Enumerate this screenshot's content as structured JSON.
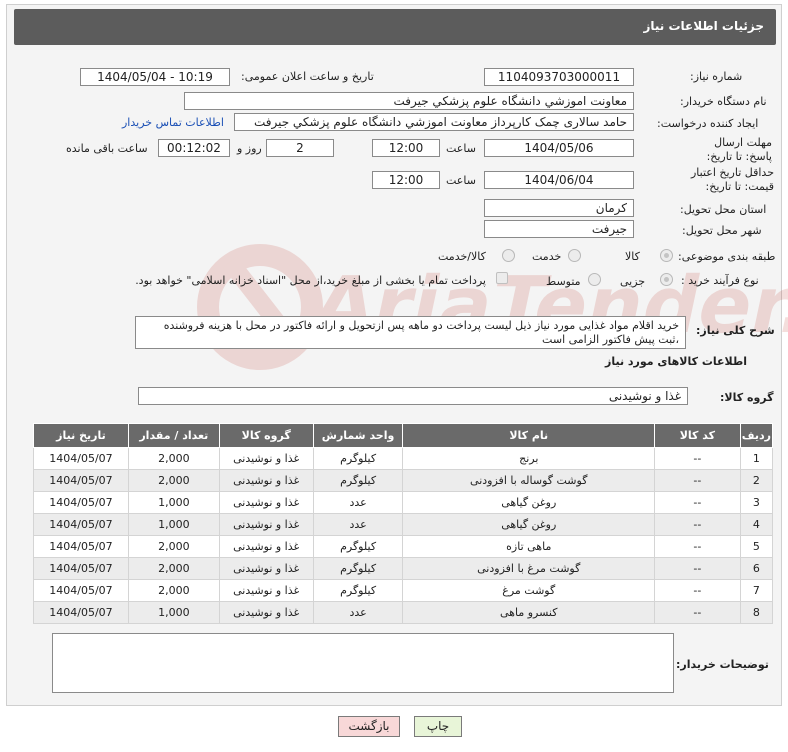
{
  "title": "جزئیات اطلاعات نیاز",
  "fields": {
    "need_number_label": "شماره نیاز:",
    "need_number": "1104093703000011",
    "announce_label": "تاریخ و ساعت اعلان عمومی:",
    "announce_value": "1404/05/04 - 10:19",
    "buyer_org_label": "نام دستگاه خریدار:",
    "buyer_org": "معاونت اموزشي دانشگاه علوم پزشکي جيرفت",
    "creator_label": "ایجاد کننده درخواست:",
    "creator": "حامد سالاری چمک کارپرداز معاونت اموزشي دانشگاه علوم پزشکي جيرفت",
    "contact_link": "اطلاعات تماس خریدار",
    "reply_deadline_label": "مهلت ارسال پاسخ: تا تاریخ:",
    "reply_date": "1404/05/06",
    "time_label": "ساعت",
    "reply_time": "12:00",
    "days_value": "2",
    "days_label": "روز و",
    "remaining_time": "00:12:02",
    "remaining_label": "ساعت باقی مانده",
    "price_validity_label": "حداقل تاریخ اعتبار قیمت: تا تاریخ:",
    "price_date": "1404/06/04",
    "price_time": "12:00",
    "province_label": "استان محل تحویل:",
    "province": "کرمان",
    "city_label": "شهر محل تحویل:",
    "city": "جيرفت",
    "category_label": "طبقه بندی موضوعی:",
    "cat_goods": "کالا",
    "cat_service": "خدمت",
    "cat_goods_service": "کالا/خدمت",
    "process_label": "نوع فرآیند خرید :",
    "proc_small": "جزیی",
    "proc_medium": "متوسط",
    "payment_note": "پرداخت تمام یا بخشی از مبلغ خرید،از محل \"اسناد خزانه اسلامی\" خواهد بود.",
    "description_label": "شرح کلی نیاز:",
    "description": "خرید اقلام مواد غذایی مورد نیاز ذیل لیست پرداخت دو ماهه پس ازتحویل و ارائه فاکتور در محل با هزینه فروشنده ،ثبت پیش فاکتور الزامی است",
    "goods_info_title": "اطلاعات کالاهای مورد نیاز",
    "goods_group_label": "گروه کالا:",
    "goods_group": "غذا و نوشیدنی",
    "buyer_notes_label": "توضیحات خریدار:",
    "buyer_notes": ""
  },
  "table": {
    "headers": [
      "ردیف",
      "کد کالا",
      "نام کالا",
      "واحد شمارش",
      "گروه کالا",
      "تعداد / مقدار",
      "تاریخ نیاز"
    ],
    "rows": [
      [
        "1",
        "--",
        "برنج",
        "کیلوگرم",
        "غذا و نوشیدنی",
        "2,000",
        "1404/05/07"
      ],
      [
        "2",
        "--",
        "گوشت گوساله با افزودنی",
        "کیلوگرم",
        "غذا و نوشیدنی",
        "2,000",
        "1404/05/07"
      ],
      [
        "3",
        "--",
        "روغن گیاهی",
        "عدد",
        "غذا و نوشیدنی",
        "1,000",
        "1404/05/07"
      ],
      [
        "4",
        "--",
        "روغن گیاهی",
        "عدد",
        "غذا و نوشیدنی",
        "1,000",
        "1404/05/07"
      ],
      [
        "5",
        "--",
        "ماهی تازه",
        "کیلوگرم",
        "غذا و نوشیدنی",
        "2,000",
        "1404/05/07"
      ],
      [
        "6",
        "--",
        "گوشت مرغ با افزودنی",
        "کیلوگرم",
        "غذا و نوشیدنی",
        "2,000",
        "1404/05/07"
      ],
      [
        "7",
        "--",
        "گوشت مرغ",
        "کیلوگرم",
        "غذا و نوشیدنی",
        "2,000",
        "1404/05/07"
      ],
      [
        "8",
        "--",
        "کنسرو ماهی",
        "عدد",
        "غذا و نوشیدنی",
        "1,000",
        "1404/05/07"
      ]
    ]
  },
  "buttons": {
    "print": "چاپ",
    "back": "بازگشت"
  },
  "colors": {
    "title_bar": "#5c5c5c",
    "table_header": "#6a6a6a",
    "print_button": "#e8f5d8",
    "back_button": "#f8d8d8",
    "link": "#1a4fb5",
    "watermark": "#c0392b"
  },
  "icons": {
    "watermark": "ariatender-logo-watermark"
  }
}
